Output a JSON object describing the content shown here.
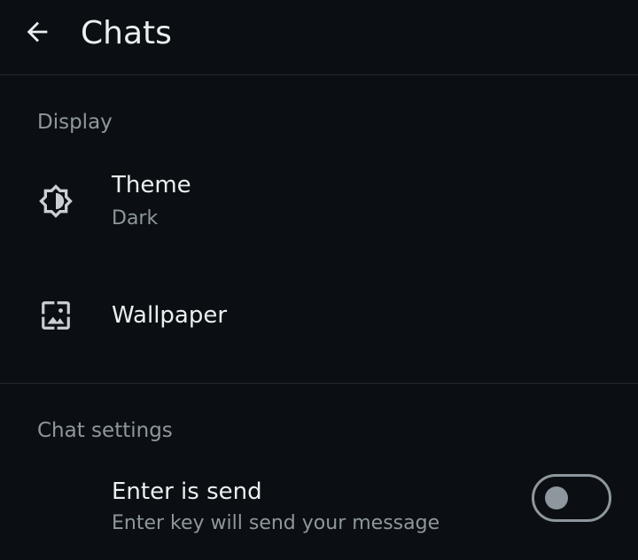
{
  "appbar": {
    "back_icon": "arrow-left-icon",
    "title": "Chats"
  },
  "sections": {
    "display": {
      "header": "Display",
      "theme": {
        "icon": "brightness-icon",
        "title": "Theme",
        "subtitle": "Dark"
      },
      "wallpaper": {
        "icon": "wallpaper-icon",
        "title": "Wallpaper"
      }
    },
    "chat_settings": {
      "header": "Chat settings",
      "enter_is_send": {
        "title": "Enter is send",
        "subtitle": "Enter key will send your message",
        "toggle_on": false
      }
    }
  },
  "colors": {
    "background": "#0b0f13",
    "primary_text": "#eceff1",
    "secondary_text": "#8e979e",
    "divider": "#222a31"
  }
}
